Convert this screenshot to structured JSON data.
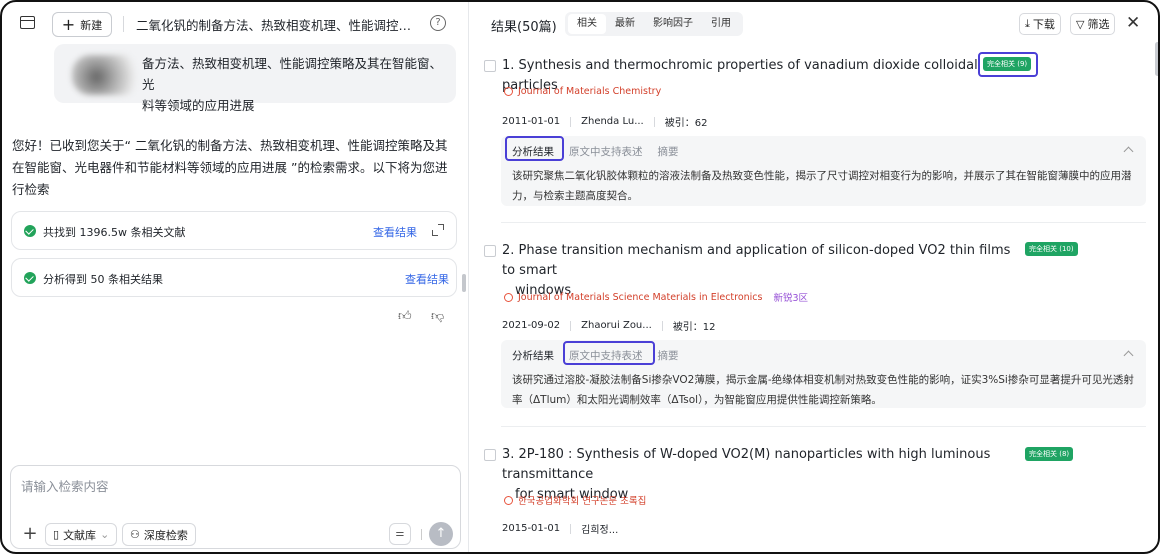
{
  "left": {
    "new_button": "新建",
    "conversation_title": "二氧化钒的制备方法、热致相变机理、性能调控策略及其在智能窗、光电器件和节能材料等领域的应用进展",
    "help": "?",
    "user_query_line1": "备方法、热致相变机理、性能调控策略及其在智能窗、光",
    "user_query_line2": "料等领域的应用进展",
    "assistant_reply": "您好！已收到您关于“ 二氧化钒的制备方法、热致相变机理、性能调控策略及其在智能窗、光电器件和节能材料等领域的应用进展 ”的检索需求。以下将为您进行检索",
    "steps": [
      {
        "text": "共找到 1396.5w 条相关文献",
        "link": "查看结果"
      },
      {
        "text": "分析得到 50 条相关结果",
        "link": "查看结果"
      }
    ],
    "input_placeholder": "请输入检索内容",
    "library_button": "文献库",
    "deep_search_button": "深度检索"
  },
  "right": {
    "results_title": "结果(50篇)",
    "tabs": [
      "相关",
      "最新",
      "影响因子",
      "引用"
    ],
    "download_button": "下载",
    "filter_button": "筛选",
    "results": [
      {
        "title_line1": "1. Synthesis and thermochromic properties of vanadium dioxide colloidal particles",
        "title_line2": "",
        "badge": "完全相关 (9)",
        "journal": "Journal of Materials Chemistry",
        "zone": "",
        "date": "2011-01-01",
        "authors": "Zhenda Lu...",
        "citations": "被引：62",
        "panel_tabs": [
          "分析结果",
          "原文中支持表述",
          "摘要"
        ],
        "summary": "该研究聚焦二氧化钒胶体颗粒的溶液法制备及热致变色性能，揭示了尺寸调控对相变行为的影响，并展示了其在智能窗薄膜中的应用潜力，与检索主题高度契合。"
      },
      {
        "title_line1": "2. Phase transition mechanism and application of silicon-doped VO2 thin films to smart",
        "title_line2": "windows",
        "badge": "完全相关 (10)",
        "journal": "Journal of Materials Science Materials in Electronics",
        "zone": "新锐3区",
        "date": "2021-09-02",
        "authors": "Zhaorui Zou...",
        "citations": "被引：12",
        "panel_tabs": [
          "分析结果",
          "原文中支持表述",
          "摘要"
        ],
        "summary": "该研究通过溶胶-凝胶法制备Si掺杂VO2薄膜，揭示金属-绝缘体相变机制对热致变色性能的影响，证实3%Si掺杂可显著提升可见光透射率（ΔTlum）和太阳光调制效率（ΔTsol），为智能窗应用提供性能调控新策略。"
      },
      {
        "title_line1": "3. 2P-180 : Synthesis of W-doped VO2(M) nanoparticles with high luminous transmittance",
        "title_line2": "for smart window",
        "badge": "完全相关 (8)",
        "journal": "한국공업화학회 연구논문 초록집",
        "zone": "",
        "date": "2015-01-01",
        "authors": "김희정...",
        "citations": ""
      }
    ]
  }
}
